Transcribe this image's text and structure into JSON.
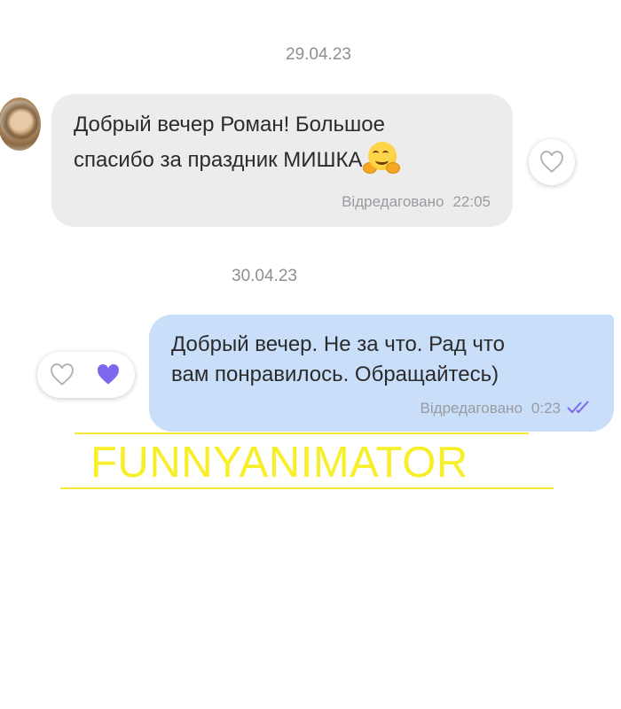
{
  "chat": {
    "messages": [
      {
        "date": "29.04.23",
        "direction": "incoming",
        "text_line1": "Добрый вечер Роман! Большое",
        "text_line2": "спасибо за праздник МИШКА",
        "emoji": "hugging-face-emoji",
        "edited_label": "Відредаговано",
        "time": "22:05",
        "reaction": "heart-outline"
      },
      {
        "date": "30.04.23",
        "direction": "outgoing",
        "text": "Добрый вечер. Не за что. Рад что\nвам понравилось. Обращайтесь)",
        "edited_label": "Відредаговано",
        "time": "0:23",
        "status_icon": "double-check-icon",
        "reactions": [
          "heart-outline",
          "heart-filled"
        ]
      }
    ]
  },
  "watermark": {
    "text": "FUNNYANIMATOR"
  },
  "colors": {
    "incoming_bubble": "#ececed",
    "outgoing_bubble": "#c9def8",
    "accent_heart": "#7b68ee",
    "watermark": "#f7ef2a"
  }
}
